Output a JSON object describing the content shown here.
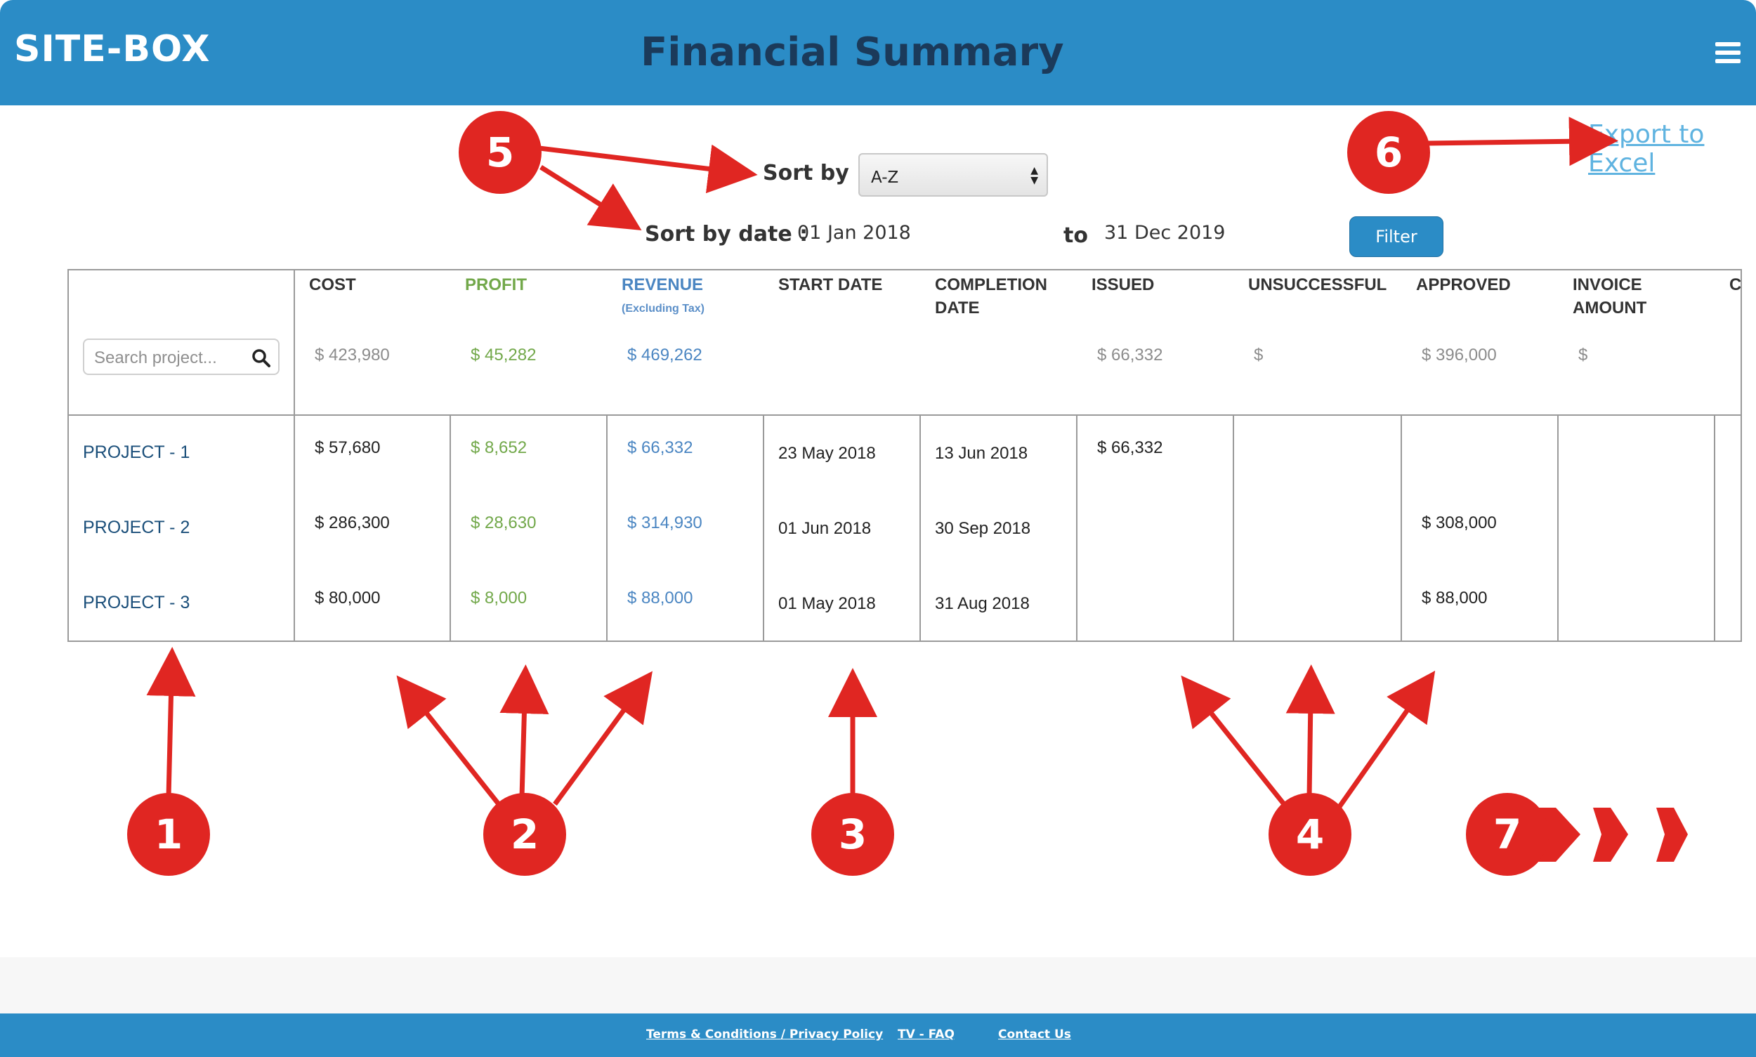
{
  "header": {
    "brand": "SITE-BOX",
    "title": "Financial Summary",
    "menu_icon": "hamburger-menu-icon"
  },
  "controls": {
    "sort_by_label": "Sort by :",
    "sort_by_value": "A-Z",
    "sort_by_date_label": "Sort by date :",
    "date_from": "01 Jan 2018",
    "to_label": "to",
    "date_to": "31 Dec 2019",
    "filter_label": "Filter",
    "export_label": "Export to Excel"
  },
  "table": {
    "search_placeholder": "Search project...",
    "search_icon": "search-icon",
    "columns": [
      {
        "title": "COST",
        "total": "$ 423,980"
      },
      {
        "title": "PROFIT",
        "total": "$ 45,282"
      },
      {
        "title": "REVENUE",
        "subtitle": "(Excluding Tax)",
        "total": "$ 469,262"
      },
      {
        "title": "START DATE",
        "total": ""
      },
      {
        "title_line1": "COMPLETION",
        "title_line2": "DATE",
        "total": ""
      },
      {
        "title": "ISSUED",
        "total": "$ 66,332"
      },
      {
        "title": "UNSUCCESSFUL",
        "total": "$"
      },
      {
        "title": "APPROVED",
        "total": "$ 396,000"
      },
      {
        "title_line1": "INVOICE",
        "title_line2": "AMOUNT",
        "total": "$"
      },
      {
        "title": "C"
      }
    ],
    "rows": [
      {
        "project": "PROJECT - 1",
        "cost": "$ 57,680",
        "profit": "$ 8,652",
        "revenue": "$ 66,332",
        "start": "23 May 2018",
        "completion": "13 Jun 2018",
        "issued": "$ 66,332",
        "unsuccessful": "",
        "approved": "",
        "invoice": ""
      },
      {
        "project": "PROJECT - 2",
        "cost": "$ 286,300",
        "profit": "$ 28,630",
        "revenue": "$ 314,930",
        "start": "01 Jun 2018",
        "completion": "30 Sep 2018",
        "issued": "",
        "unsuccessful": "",
        "approved": "$ 308,000",
        "invoice": ""
      },
      {
        "project": "PROJECT - 3",
        "cost": "$ 80,000",
        "profit": "$ 8,000",
        "revenue": "$ 88,000",
        "start": "01 May 2018",
        "completion": "31 Aug 2018",
        "issued": "",
        "unsuccessful": "",
        "approved": "$ 88,000",
        "invoice": ""
      }
    ]
  },
  "annotations": {
    "badges": [
      "1",
      "2",
      "3",
      "4",
      "5",
      "6",
      "7"
    ]
  },
  "footer": {
    "links": [
      "Terms & Conditions / Privacy Policy",
      "TV - FAQ",
      "Contact Us"
    ]
  },
  "colors": {
    "header": "#2b8cc6",
    "profit": "#72a84a",
    "revenue": "#4b86c2",
    "annotation": "#e02622"
  }
}
